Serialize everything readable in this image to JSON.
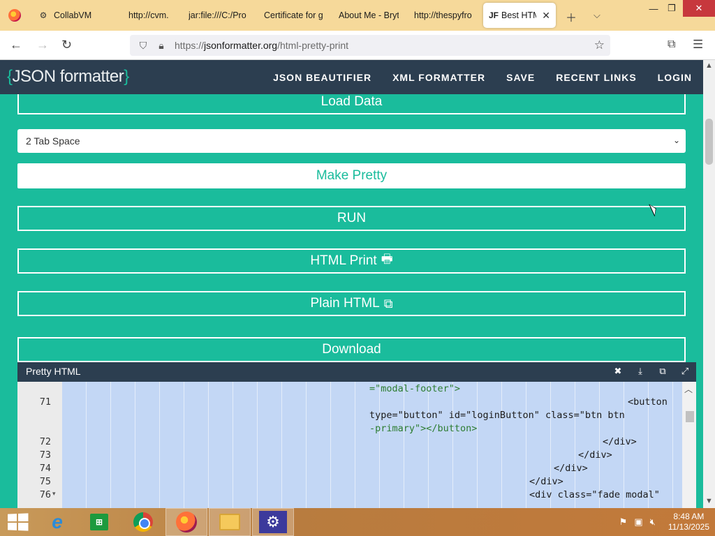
{
  "browser": {
    "tabs": [
      {
        "label": "CollabVM",
        "icon": "gear-icon"
      },
      {
        "label": "http://cvm.",
        "icon": ""
      },
      {
        "label": "jar:file:///C:/Pro",
        "icon": ""
      },
      {
        "label": "Certificate for g",
        "icon": ""
      },
      {
        "label": "About Me - Bryt",
        "icon": ""
      },
      {
        "label": "http://thespyfro",
        "icon": ""
      },
      {
        "label": "Best HTM",
        "icon": "JF"
      }
    ],
    "active_tab_favicon": "JF",
    "url_prefix": "https://",
    "url_host": "jsonformatter.org",
    "url_path": "/html-pretty-print"
  },
  "site": {
    "logo_open": "{",
    "logo_text": "JSON formatter",
    "logo_close": "}",
    "nav": [
      "JSON BEAUTIFIER",
      "XML FORMATTER",
      "SAVE",
      "RECENT LINKS",
      "LOGIN"
    ]
  },
  "controls": {
    "load_data": "Load Data",
    "indent_select": "2 Tab Space",
    "make_pretty": "Make Pretty",
    "run": "RUN",
    "html_print": "HTML Print",
    "plain_html": "Plain HTML",
    "download": "Download"
  },
  "editor": {
    "title": "Pretty HTML",
    "line_numbers": [
      "71",
      "",
      "",
      "72",
      "73",
      "74",
      "75",
      "76"
    ],
    "lines": [
      {
        "num": "",
        "text": "=\"modal-footer\">"
      },
      {
        "num": "71",
        "text": "<button"
      },
      {
        "num": "",
        "text": "type=\"button\" id=\"loginButton\" class=\"btn btn"
      },
      {
        "num": "",
        "text": "-primary\"></button>"
      },
      {
        "num": "72",
        "text": "</div>"
      },
      {
        "num": "73",
        "text": "</div>"
      },
      {
        "num": "74",
        "text": "</div>"
      },
      {
        "num": "75",
        "text": "</div>"
      },
      {
        "num": "76",
        "text": "<div class=\"fade modal\""
      }
    ]
  },
  "taskbar": {
    "time": "8:48 AM",
    "date": "11/13/2025"
  },
  "colors": {
    "page_bg": "#1abc9c",
    "header_bg": "#2c3e50",
    "selection": "#c3d7f5"
  }
}
